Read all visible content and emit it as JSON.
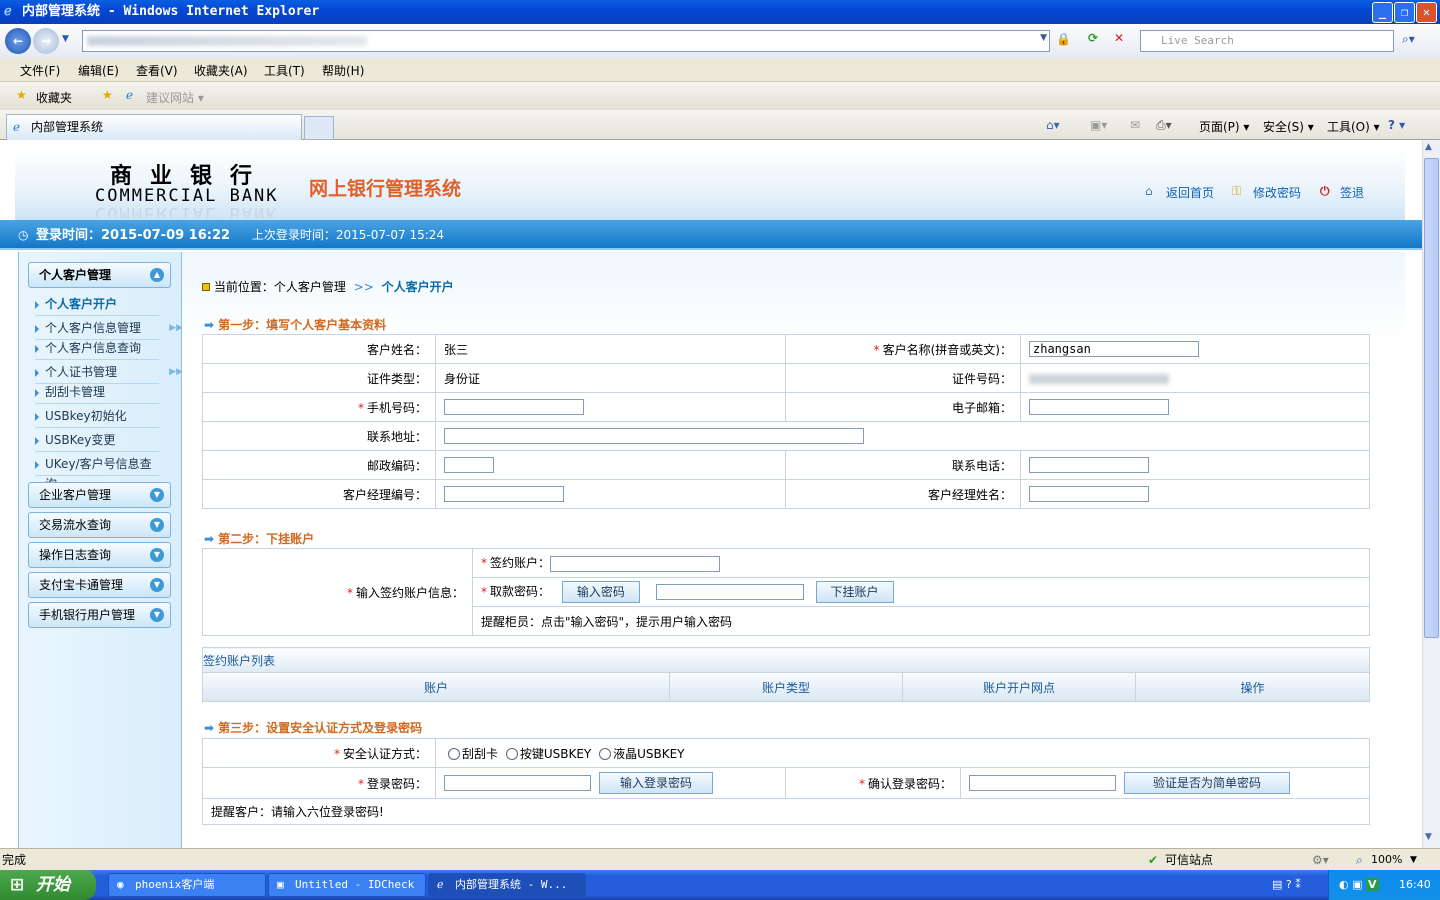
{
  "window": {
    "title": "内部管理系统 - Windows Internet Explorer",
    "min": "_",
    "max": "❐",
    "close": "✕"
  },
  "browser": {
    "search_placeholder": "Live Search",
    "menu": [
      "文件(F)",
      "编辑(E)",
      "查看(V)",
      "收藏夹(A)",
      "工具(T)",
      "帮助(H)"
    ],
    "favorites_label": "收藏夹",
    "suggested_sites": "建议网站 ▾",
    "tab_title": "内部管理系统",
    "commands": {
      "page": "页面(P) ▾",
      "safety": "安全(S) ▾",
      "tools": "工具(O) ▾",
      "help": "? ▾"
    },
    "status_text": "完成",
    "zone": "可信站点",
    "zoom": "100%"
  },
  "page": {
    "logo_cn": "商业银行",
    "logo_en": "COMMERCIAL BANK",
    "system_title": "网上银行管理系统",
    "header_links": {
      "home": "返回首页",
      "change_password": "修改密码",
      "logout": "签退"
    },
    "login_time": "登录时间：2015-07-09 16:22",
    "last_login": "上次登录时间：2015-07-07 15:24",
    "sidebar": {
      "groups": [
        {
          "label": "个人客户管理",
          "expanded": true,
          "items": [
            {
              "label": "个人客户开户",
              "active": true,
              "more": false
            },
            {
              "label": "个人客户信息管理",
              "more": true
            },
            {
              "label": "个人客户信息查询",
              "more": false
            },
            {
              "label": "个人证书管理",
              "more": true
            },
            {
              "label": "刮刮卡管理",
              "more": false
            },
            {
              "label": "USBkey初始化",
              "more": false
            },
            {
              "label": "USBKey变更",
              "more": false
            },
            {
              "label": "UKey/客户号信息查询",
              "more": false
            }
          ]
        },
        {
          "label": "企业客户管理"
        },
        {
          "label": "交易流水查询"
        },
        {
          "label": "操作日志查询"
        },
        {
          "label": "支付宝卡通管理"
        },
        {
          "label": "手机银行用户管理"
        }
      ]
    },
    "breadcrumb": {
      "prefix": "当前位置：个人客户管理",
      "sep": ">>",
      "current": "个人客户开户"
    },
    "step1": {
      "title": "第一步：填写个人客户基本资料",
      "name_label": "客户姓名：",
      "name_value": "张三",
      "ename_label": "客户名称(拼音或英文)：",
      "ename_value": "zhangsan",
      "idtype_label": "证件类型：",
      "idtype_value": "身份证",
      "idno_label": "证件号码：",
      "mobile_label": "手机号码：",
      "email_label": "电子邮箱：",
      "address_label": "联系地址：",
      "zip_label": "邮政编码：",
      "phone_label": "联系电话：",
      "mgr_no_label": "客户经理编号：",
      "mgr_name_label": "客户经理姓名："
    },
    "step2": {
      "title": "第二步：下挂账户",
      "info_label": "输入签约账户信息：",
      "account_label": "签约账户：",
      "pwd_label": "取款密码：",
      "enter_pwd_btn": "输入密码",
      "attach_btn": "下挂账户",
      "hint": "提醒柜员：点击\"输入密码\"，提示用户输入密码"
    },
    "accounts": {
      "title": "签约账户列表",
      "columns": [
        "账户",
        "账户类型",
        "账户开户网点",
        "操作"
      ]
    },
    "step3": {
      "title": "第三步：设置安全认证方式及登录密码",
      "auth_label": "安全认证方式：",
      "auth_options": [
        "刮刮卡",
        "按键USBKEY",
        "液晶USBKEY"
      ],
      "login_pwd_label": "登录密码：",
      "enter_login_pwd_btn": "输入登录密码",
      "confirm_pwd_label": "确认登录密码：",
      "check_simple_btn": "验证是否为简单密码",
      "hint": "提醒客户：请输入六位登录密码!"
    }
  },
  "taskbar": {
    "start": "开始",
    "tasks": [
      "phoenix客户端",
      "Untitled - IDCheck",
      "内部管理系统 - W..."
    ],
    "clock": "16:40"
  }
}
